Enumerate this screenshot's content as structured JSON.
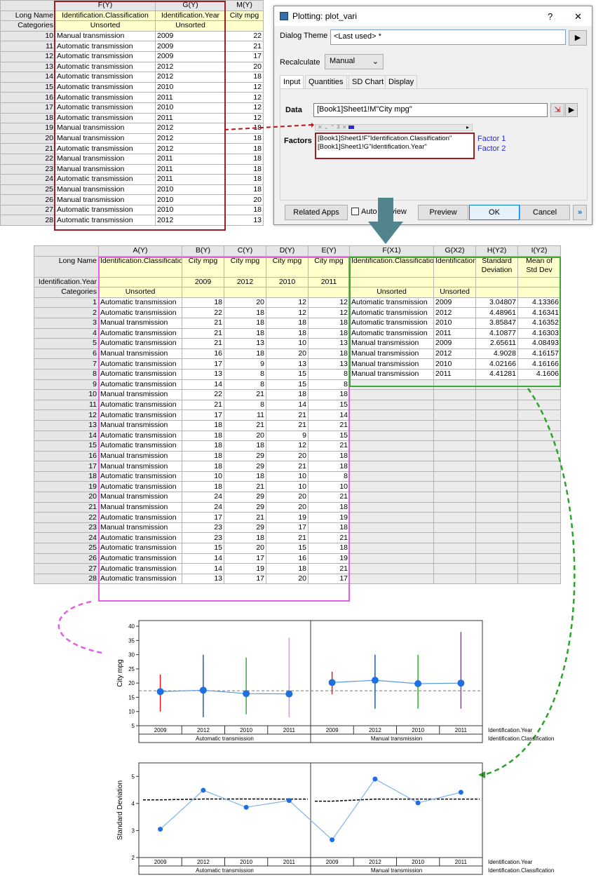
{
  "top_sheet": {
    "columns": [
      "F(Y)",
      "G(Y)",
      "M(Y)"
    ],
    "meta_rows": [
      {
        "label": "Long Name",
        "cells": [
          "Identification.Classification",
          "Identification.Year",
          "City mpg"
        ]
      },
      {
        "label": "Categories",
        "cells": [
          "Unsorted",
          "Unsorted",
          ""
        ]
      }
    ],
    "rows": [
      [
        "10",
        "Manual transmission",
        "2009",
        "22"
      ],
      [
        "11",
        "Automatic transmission",
        "2009",
        "21"
      ],
      [
        "12",
        "Automatic transmission",
        "2009",
        "17"
      ],
      [
        "13",
        "Automatic transmission",
        "2012",
        "20"
      ],
      [
        "14",
        "Automatic transmission",
        "2012",
        "18"
      ],
      [
        "15",
        "Automatic transmission",
        "2010",
        "12"
      ],
      [
        "16",
        "Automatic transmission",
        "2011",
        "12"
      ],
      [
        "17",
        "Automatic transmission",
        "2010",
        "12"
      ],
      [
        "18",
        "Automatic transmission",
        "2011",
        "12"
      ],
      [
        "19",
        "Manual transmission",
        "2012",
        "18"
      ],
      [
        "20",
        "Manual transmission",
        "2012",
        "18"
      ],
      [
        "21",
        "Automatic transmission",
        "2012",
        "18"
      ],
      [
        "22",
        "Manual transmission",
        "2011",
        "18"
      ],
      [
        "23",
        "Manual transmission",
        "2011",
        "18"
      ],
      [
        "24",
        "Automatic transmission",
        "2011",
        "18"
      ],
      [
        "25",
        "Manual transmission",
        "2010",
        "18"
      ],
      [
        "26",
        "Manual transmission",
        "2010",
        "20"
      ],
      [
        "27",
        "Automatic transmission",
        "2010",
        "18"
      ],
      [
        "28",
        "Automatic transmission",
        "2012",
        "13"
      ]
    ]
  },
  "dialog": {
    "title": "Plotting: plot_vari",
    "help": "?",
    "close": "✕",
    "theme_label": "Dialog Theme",
    "theme_value": "<Last used> *",
    "recalc_label": "Recalculate",
    "recalc_value": "Manual",
    "tabs": [
      "Input",
      "Quantities",
      "SD Chart",
      "Display"
    ],
    "data_label": "Data",
    "data_value": "[Book1]Sheet1!M\"City mpg\"",
    "factors_label": "Factors",
    "factors": [
      "[Book1]Sheet1!F\"Identification.Classification\"",
      "[Book1]Sheet1!G\"Identification.Year\""
    ],
    "factor_labels": [
      "Factor 1",
      "Factor 2"
    ],
    "buttons": {
      "related": "Related Apps",
      "auto_preview": "Auto Preview",
      "preview": "Preview",
      "ok": "OK",
      "cancel": "Cancel",
      "more": "»"
    }
  },
  "main_sheet": {
    "columns": [
      "A(Y)",
      "B(Y)",
      "C(Y)",
      "D(Y)",
      "E(Y)",
      "F(X1)",
      "G(X2)",
      "H(Y2)",
      "I(Y2)"
    ],
    "long_name": [
      "Identification.Classification",
      "City mpg",
      "City mpg",
      "City mpg",
      "City mpg",
      "Identification.Classification",
      "Identification.Year",
      "Standard Deviation",
      "Mean of Std Dev"
    ],
    "id_year": [
      "",
      "2009",
      "2012",
      "2010",
      "2011",
      "",
      "",
      "",
      ""
    ],
    "categories": [
      "Unsorted",
      "",
      "",
      "",
      "",
      "Unsorted",
      "Unsorted",
      "",
      ""
    ],
    "row_labels": [
      "Long Name",
      "Identification.Year",
      "Categories"
    ],
    "rows": [
      [
        "Automatic transmission",
        "18",
        "20",
        "12",
        "12",
        "Automatic transmission",
        "2009",
        "3.04807",
        "4.13366"
      ],
      [
        "Automatic transmission",
        "22",
        "18",
        "12",
        "12",
        "Automatic transmission",
        "2012",
        "4.48961",
        "4.16341"
      ],
      [
        "Manual transmission",
        "21",
        "18",
        "18",
        "18",
        "Automatic transmission",
        "2010",
        "3.85847",
        "4.16352"
      ],
      [
        "Automatic transmission",
        "21",
        "18",
        "18",
        "18",
        "Automatic transmission",
        "2011",
        "4.10877",
        "4.16303"
      ],
      [
        "Automatic transmission",
        "21",
        "13",
        "10",
        "13",
        "Manual transmission",
        "2009",
        "2.65611",
        "4.08493"
      ],
      [
        "Manual transmission",
        "16",
        "18",
        "20",
        "18",
        "Manual transmission",
        "2012",
        "4.9028",
        "4.16157"
      ],
      [
        "Automatic transmission",
        "17",
        "9",
        "13",
        "13",
        "Manual transmission",
        "2010",
        "4.02166",
        "4.16166"
      ],
      [
        "Automatic transmission",
        "13",
        "8",
        "15",
        "8",
        "Manual transmission",
        "2011",
        "4.41281",
        "4.1606"
      ],
      [
        "Automatic transmission",
        "14",
        "8",
        "15",
        "8",
        "",
        "",
        "",
        ""
      ],
      [
        "Manual transmission",
        "22",
        "21",
        "18",
        "18",
        "",
        "",
        "",
        ""
      ],
      [
        "Automatic transmission",
        "21",
        "8",
        "14",
        "15",
        "",
        "",
        "",
        ""
      ],
      [
        "Automatic transmission",
        "17",
        "11",
        "21",
        "14",
        "",
        "",
        "",
        ""
      ],
      [
        "Manual transmission",
        "18",
        "21",
        "21",
        "21",
        "",
        "",
        "",
        ""
      ],
      [
        "Automatic transmission",
        "18",
        "20",
        "9",
        "15",
        "",
        "",
        "",
        ""
      ],
      [
        "Automatic transmission",
        "18",
        "18",
        "12",
        "21",
        "",
        "",
        "",
        ""
      ],
      [
        "Manual transmission",
        "18",
        "29",
        "20",
        "18",
        "",
        "",
        "",
        ""
      ],
      [
        "Manual transmission",
        "18",
        "29",
        "21",
        "18",
        "",
        "",
        "",
        ""
      ],
      [
        "Automatic transmission",
        "10",
        "18",
        "10",
        "8",
        "",
        "",
        "",
        ""
      ],
      [
        "Automatic transmission",
        "18",
        "21",
        "10",
        "10",
        "",
        "",
        "",
        ""
      ],
      [
        "Manual transmission",
        "24",
        "29",
        "20",
        "21",
        "",
        "",
        "",
        ""
      ],
      [
        "Manual transmission",
        "24",
        "29",
        "20",
        "18",
        "",
        "",
        "",
        ""
      ],
      [
        "Automatic transmission",
        "17",
        "21",
        "19",
        "19",
        "",
        "",
        "",
        ""
      ],
      [
        "Manual transmission",
        "23",
        "29",
        "17",
        "18",
        "",
        "",
        "",
        ""
      ],
      [
        "Automatic transmission",
        "23",
        "18",
        "21",
        "21",
        "",
        "",
        "",
        ""
      ],
      [
        "Automatic transmission",
        "15",
        "20",
        "15",
        "18",
        "",
        "",
        "",
        ""
      ],
      [
        "Automatic transmission",
        "14",
        "17",
        "16",
        "19",
        "",
        "",
        "",
        ""
      ],
      [
        "Automatic transmission",
        "14",
        "19",
        "18",
        "21",
        "",
        "",
        "",
        ""
      ],
      [
        "Automatic transmission",
        "13",
        "17",
        "20",
        "17",
        "",
        "",
        "",
        ""
      ]
    ]
  },
  "chart_data": [
    {
      "type": "scatter",
      "title": "",
      "ylabel": "City mpg",
      "ylim": [
        5,
        42
      ],
      "yticks": [
        5,
        10,
        15,
        20,
        25,
        30,
        35,
        40
      ],
      "groups": [
        "Automatic transmission",
        "Manual transmission"
      ],
      "categories": [
        "2009",
        "2012",
        "2010",
        "2011"
      ],
      "x_axis_labels": [
        "Identification.Year",
        "Identification.Classification"
      ],
      "means": [
        [
          17,
          17.5,
          16.3,
          16.2
        ],
        [
          20.2,
          21,
          19.8,
          20
        ]
      ],
      "ranges": [
        [
          [
            10,
            23
          ],
          [
            8,
            30
          ],
          [
            9,
            29
          ],
          [
            8,
            36
          ]
        ],
        [
          [
            16,
            24
          ],
          [
            11,
            30
          ],
          [
            11,
            30
          ],
          [
            11,
            38
          ]
        ]
      ],
      "range_colors": [
        "#e8191d",
        "#1f5ea8",
        "#3aaa35",
        "#c7a0d6"
      ],
      "range_colors_manual": [
        "#e8191d",
        "#1f5ea8",
        "#3aaa35",
        "#9b3ca4"
      ],
      "grand_mean": 17.3
    },
    {
      "type": "line",
      "title": "",
      "ylabel": "Standard Deviation",
      "ylim": [
        2,
        5.5
      ],
      "yticks": [
        2,
        3,
        4,
        5
      ],
      "groups": [
        "Automatic transmission",
        "Manual transmission"
      ],
      "categories": [
        "2009",
        "2012",
        "2010",
        "2011"
      ],
      "x_axis_labels": [
        "Identification.Year",
        "Identification.Classification"
      ],
      "values": [
        3.04807,
        4.48961,
        3.85847,
        4.10877,
        2.65611,
        4.9028,
        4.02166,
        4.41281
      ],
      "mean_line": [
        4.13366,
        4.16341,
        4.16352,
        4.16303,
        4.08493,
        4.16157,
        4.16166,
        4.1606
      ]
    }
  ]
}
